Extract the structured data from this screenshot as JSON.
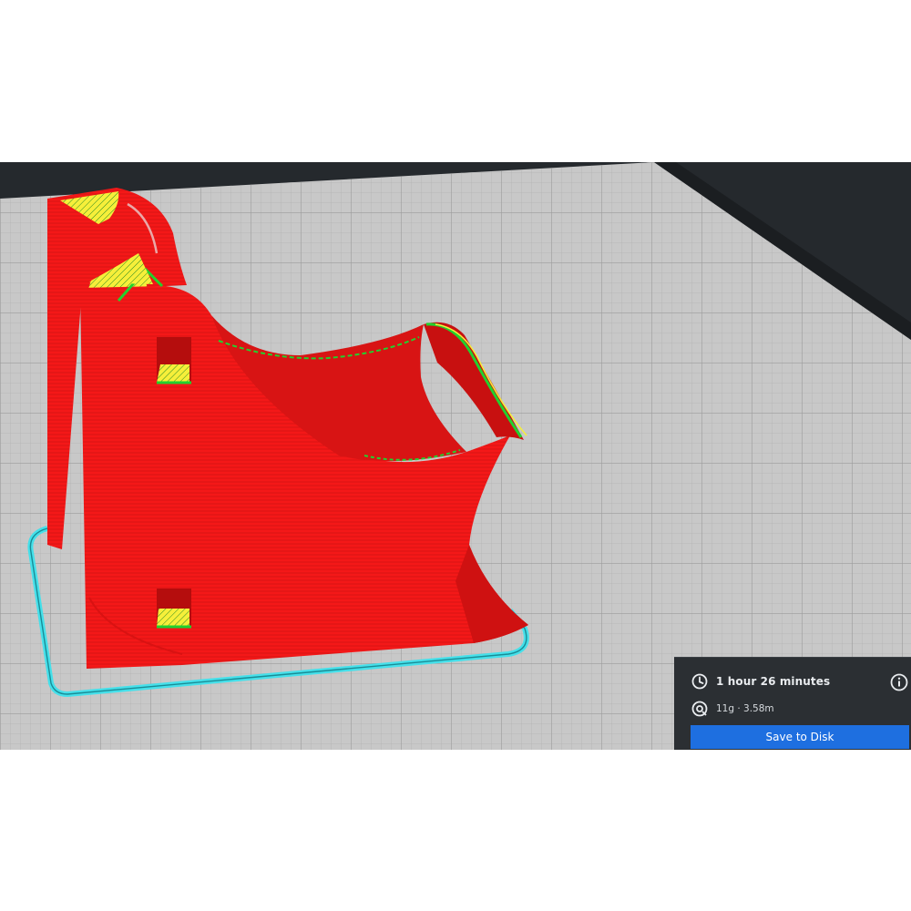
{
  "print_info": {
    "time_icon": "clock-icon",
    "time_label": "1 hour 26 minutes",
    "material_icon": "filament-spool-icon",
    "material_label": "11g · 3.58m",
    "info_icon": "info-icon",
    "save_label": "Save to Disk"
  },
  "colors": {
    "viewport_bg": "#25292d",
    "build_plate": "#c8c8c8",
    "grid_line": "#a9a9a9",
    "wall_red": "#f41818",
    "infill_yellow": "#f6ef3a",
    "skin_green": "#22d12e",
    "skirt_cyan": "#45e0ea",
    "panel_bg": "#2b2f33",
    "accent_blue": "#1e6fe0"
  }
}
